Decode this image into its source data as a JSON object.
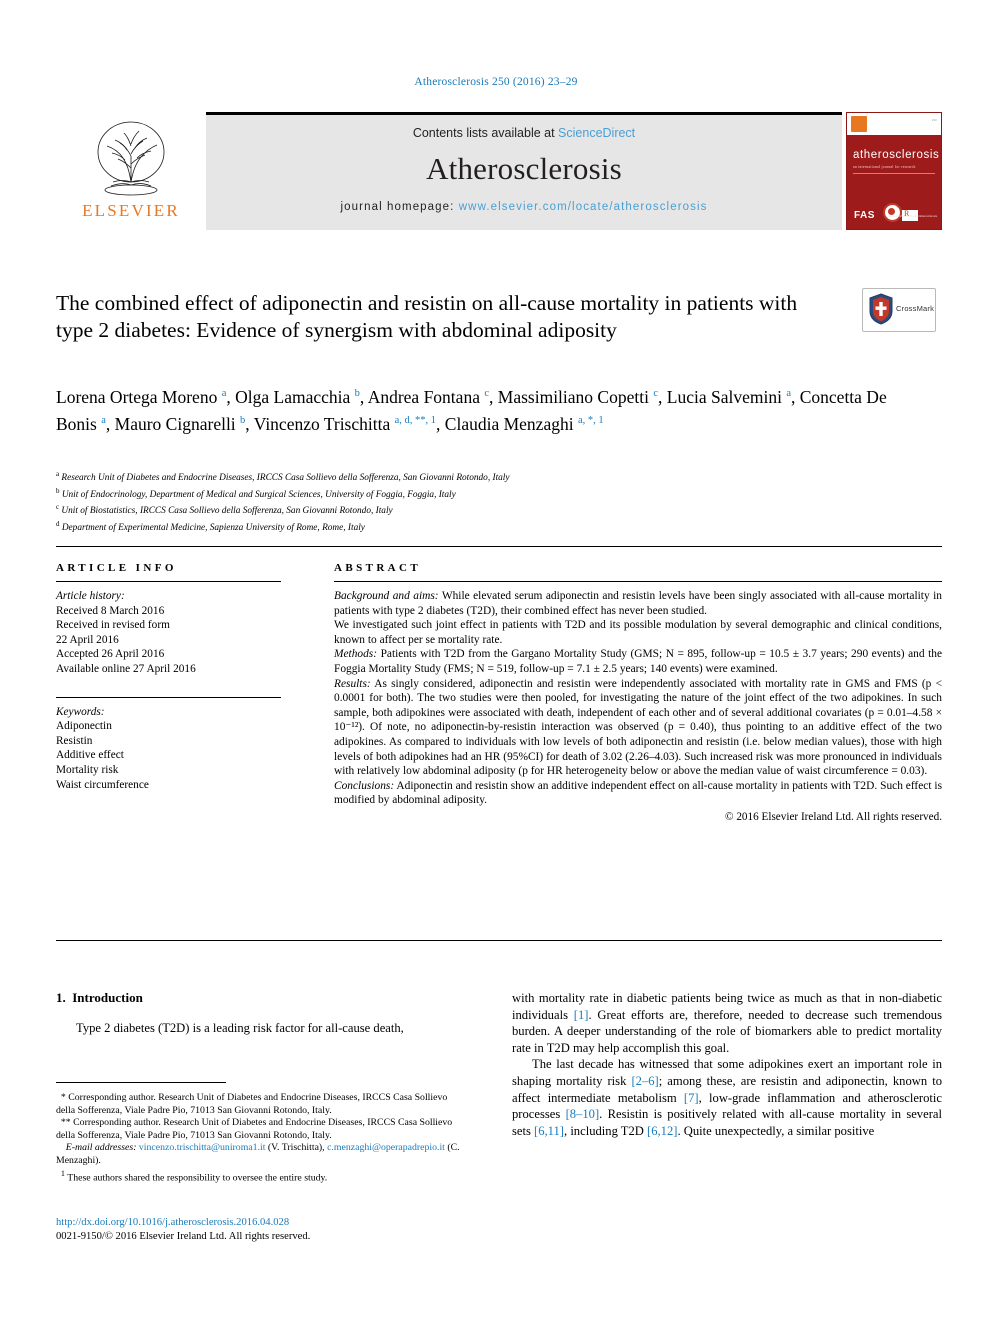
{
  "running_head": "Atherosclerosis 250 (2016) 23–29",
  "masthead": {
    "publisher": "ELSEVIER",
    "contents_prefix": "Contents lists available at ",
    "contents_link": "ScienceDirect",
    "journal_name": "Atherosclerosis",
    "homepage_prefix": "journal homepage: ",
    "homepage_url": "www.elsevier.com/locate/atherosclerosis",
    "cover": {
      "title": "atherosclerosis",
      "subtitle": "an international journal for research",
      "society": "FAS",
      "url": "www.elsevier.com/locate/atherosclerosis"
    }
  },
  "crossmark": {
    "label": "CrossMark"
  },
  "article": {
    "title": "The combined effect of adiponectin and resistin on all-cause mortality in patients with type 2 diabetes: Evidence of synergism with abdominal adiposity",
    "authors": [
      {
        "name": "Lorena Ortega Moreno",
        "marks": "a",
        "sep": ", "
      },
      {
        "name": "Olga Lamacchia",
        "marks": "b",
        "sep": ", "
      },
      {
        "name": "Andrea Fontana",
        "marks": "c",
        "sep": ", "
      },
      {
        "name": "Massimiliano Copetti",
        "marks": "c",
        "sep": ", "
      },
      {
        "name": "Lucia Salvemini",
        "marks": "a",
        "sep": ", "
      },
      {
        "name": "Concetta De Bonis",
        "marks": "a",
        "sep": ", "
      },
      {
        "name": "Mauro Cignarelli",
        "marks": "b",
        "sep": ", "
      },
      {
        "name": "Vincenzo Trischitta",
        "marks": "a, d, **, 1",
        "sep": ", "
      },
      {
        "name": "Claudia Menzaghi",
        "marks": "a, *, 1",
        "sep": ""
      }
    ],
    "affiliations": [
      {
        "mark": "a",
        "text": "Research Unit of Diabetes and Endocrine Diseases, IRCCS Casa Sollievo della Sofferenza, San Giovanni Rotondo, Italy"
      },
      {
        "mark": "b",
        "text": "Unit of Endocrinology, Department of Medical and Surgical Sciences, University of Foggia, Foggia, Italy"
      },
      {
        "mark": "c",
        "text": "Unit of Biostatistics, IRCCS Casa Sollievo della Sofferenza, San Giovanni Rotondo, Italy"
      },
      {
        "mark": "d",
        "text": "Department of Experimental Medicine, Sapienza University of Rome, Rome, Italy"
      }
    ]
  },
  "article_info": {
    "heading": "ARTICLE INFO",
    "history_label": "Article history:",
    "history": [
      "Received 8 March 2016",
      "Received in revised form",
      "22 April 2016",
      "Accepted 26 April 2016",
      "Available online 27 April 2016"
    ],
    "keywords_label": "Keywords:",
    "keywords": [
      "Adiponectin",
      "Resistin",
      "Additive effect",
      "Mortality risk",
      "Waist circumference"
    ]
  },
  "abstract": {
    "heading": "ABSTRACT",
    "paragraphs": [
      {
        "label": "Background and aims:",
        "text": " While elevated serum adiponectin and resistin levels have been singly associated with all-cause mortality in patients with type 2 diabetes (T2D), their combined effect has never been studied."
      },
      {
        "label": "",
        "text": "We investigated such joint effect in patients with T2D and its possible modulation by several demographic and clinical conditions, known to affect per se mortality rate."
      },
      {
        "label": "Methods:",
        "text": " Patients with T2D from the Gargano Mortality Study (GMS; N = 895, follow-up = 10.5 ± 3.7 years; 290 events) and the Foggia Mortality Study (FMS; N = 519, follow-up = 7.1 ± 2.5 years; 140 events) were examined."
      },
      {
        "label": "Results:",
        "text": " As singly considered, adiponectin and resistin were independently associated with mortality rate in GMS and FMS (p < 0.0001 for both). The two studies were then pooled, for investigating the nature of the joint effect of the two adipokines. In such sample, both adipokines were associated with death, independent of each other and of several additional covariates (p = 0.01–4.58 × 10⁻¹²). Of note, no adiponectin-by-resistin interaction was observed (p = 0.40), thus pointing to an additive effect of the two adipokines. As compared to individuals with low levels of both adiponectin and resistin (i.e. below median values), those with high levels of both adipokines had an HR (95%CI) for death of 3.02 (2.26–4.03). Such increased risk was more pronounced in individuals with relatively low abdominal adiposity (p for HR heterogeneity below or above the median value of waist circumference = 0.03)."
      },
      {
        "label": "Conclusions:",
        "text": " Adiponectin and resistin show an additive independent effect on all-cause mortality in patients with T2D. Such effect is modified by abdominal adiposity."
      }
    ],
    "copyright": "© 2016 Elsevier Ireland Ltd. All rights reserved."
  },
  "introduction": {
    "number": "1.",
    "heading": "Introduction",
    "left_paragraphs": [
      "Type 2 diabetes (T2D) is a leading risk factor for all-cause death,"
    ],
    "right_paragraphs": [
      {
        "parts": [
          {
            "t": "with mortality rate in diabetic patients being twice as much as that in non-diabetic individuals "
          },
          {
            "t": "[1]",
            "ref": true
          },
          {
            "t": ". Great efforts are, therefore, needed to decrease such tremendous burden. A deeper understanding of the role of biomarkers able to predict mortality rate in T2D may help accomplish this goal."
          }
        ]
      },
      {
        "indent": true,
        "parts": [
          {
            "t": "The last decade has witnessed that some adipokines exert an important role in shaping mortality risk "
          },
          {
            "t": "[2–6]",
            "ref": true
          },
          {
            "t": "; among these, are resistin and adiponectin, known to affect intermediate metabolism "
          },
          {
            "t": "[7]",
            "ref": true
          },
          {
            "t": ", low-grade inflammation and atherosclerotic processes "
          },
          {
            "t": "[8–10]",
            "ref": true
          },
          {
            "t": ". Resistin is positively related with all-cause mortality in several sets "
          },
          {
            "t": "[6,11]",
            "ref": true
          },
          {
            "t": ", including T2D "
          },
          {
            "t": "[6,12]",
            "ref": true
          },
          {
            "t": ". Quite unexpectedly, a similar positive"
          }
        ]
      }
    ]
  },
  "footnotes": [
    {
      "mark": "*",
      "text": " Corresponding author. Research Unit of Diabetes and Endocrine Diseases, IRCCS Casa Sollievo della Sofferenza, Viale Padre Pio, 71013 San Giovanni Rotondo, Italy."
    },
    {
      "mark": "**",
      "text": " Corresponding author. Research Unit of Diabetes and Endocrine Diseases, IRCCS Casa Sollievo della Sofferenza, Viale Padre Pio, 71013 San Giovanni Rotondo, Italy."
    }
  ],
  "email_note": {
    "label": "E-mail addresses:",
    "email1": "vincenzo.trischitta@uniroma1.it",
    "author1": " (V. Trischitta), ",
    "email2": "c.menzaghi@operapadrepio.it",
    "author2": " (C. Menzaghi)."
  },
  "shared_note": {
    "mark": "1",
    "text": " These authors shared the responsibility to oversee the entire study."
  },
  "doi": {
    "url": "http://dx.doi.org/10.1016/j.atherosclerosis.2016.04.028",
    "issn_line": "0021-9150/© 2016 Elsevier Ireland Ltd. All rights reserved."
  }
}
